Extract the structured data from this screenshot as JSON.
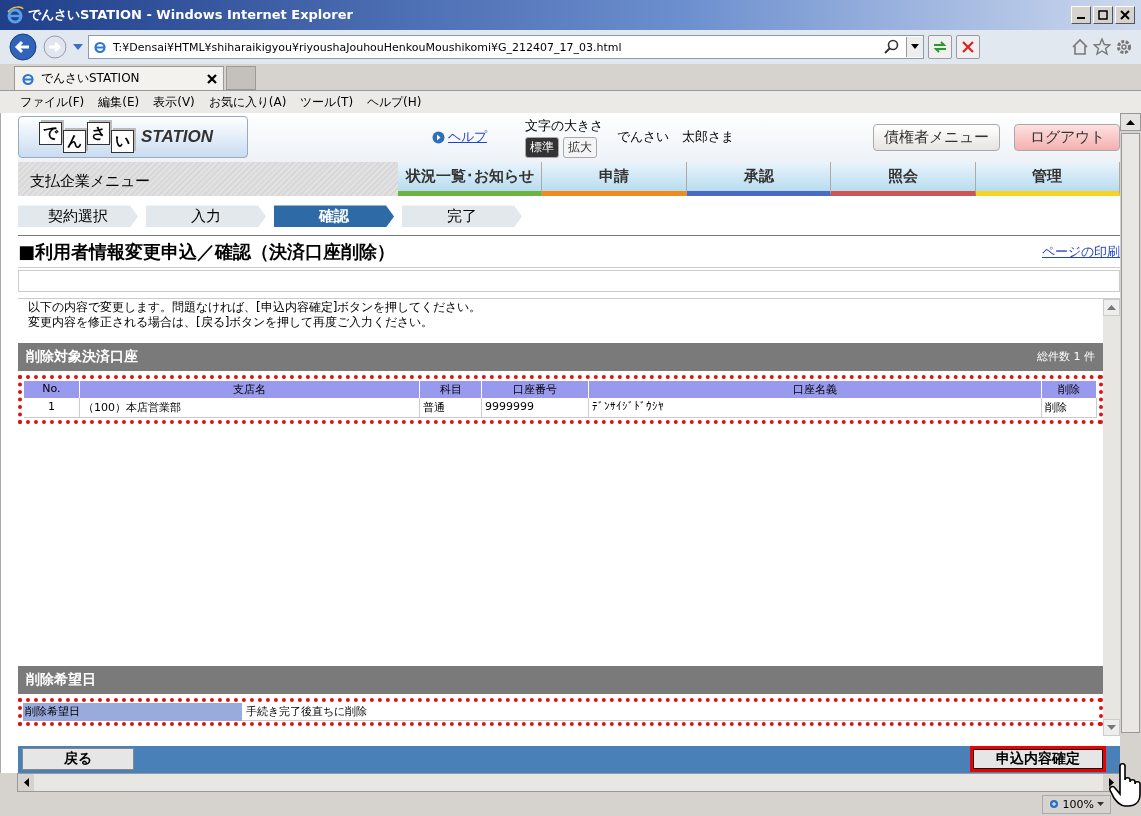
{
  "window": {
    "title": "でんさいSTATION - Windows Internet Explorer"
  },
  "address_bar": {
    "url": "T:¥Densai¥HTML¥shiharaikigyou¥riyoushaJouhouHenkouMoushikomi¥G_212407_17_03.html"
  },
  "browser_tabs": [
    {
      "label": "でんさいSTATION",
      "selected": true
    }
  ],
  "menu_bar": [
    "ファイル(F)",
    "編集(E)",
    "表示(V)",
    "お気に入り(A)",
    "ツール(T)",
    "ヘルプ(H)"
  ],
  "header": {
    "logo_letters": [
      "で",
      "ん",
      "さ",
      "い"
    ],
    "logo_text": "STATION",
    "help_link": "ヘルプ",
    "text_size_label": "文字の大きさ",
    "text_sizes": [
      {
        "label": "標準",
        "selected": true
      },
      {
        "label": "拡大",
        "selected": false
      }
    ],
    "user": "でんさい　太郎さま",
    "buttons": [
      {
        "label": "債権者メニュー",
        "kind": "normal"
      },
      {
        "label": "ログアウト",
        "kind": "logout"
      }
    ]
  },
  "nav": {
    "menu_title": "支払企業メニュー",
    "items": [
      {
        "label": "状況一覧･お知らせ",
        "color": "#6db33f"
      },
      {
        "label": "申請",
        "color": "#f08c1e"
      },
      {
        "label": "承認",
        "color": "#4a6cc0"
      },
      {
        "label": "照会",
        "color": "#d05454"
      },
      {
        "label": "管理",
        "color": "#f5d423"
      }
    ]
  },
  "steps": [
    {
      "label": "契約選択",
      "selected": false
    },
    {
      "label": "入力",
      "selected": false
    },
    {
      "label": "確認",
      "selected": true
    },
    {
      "label": "完了",
      "selected": false
    }
  ],
  "page": {
    "title": "■利用者情報変更申込／確認（決済口座削除）",
    "print_link": "ページの印刷",
    "message": [
      "以下の内容で変更します。問題なければ、[申込内容確定]ボタンを押してください。",
      "変更内容を修正される場合は、[戻る]ボタンを押して再度ご入力ください。"
    ]
  },
  "accounts_section": {
    "title": "削除対象決済口座",
    "total": "総件数 1 件",
    "table": {
      "columns": [
        "No.",
        "支店名",
        "科目",
        "口座番号",
        "口座名義",
        "削除"
      ],
      "rows": [
        [
          "1",
          "（100）本店営業部",
          "普通",
          "9999999",
          "ﾃﾞﾝｻｲｼﾞﾄﾞｳｼﾔ",
          "削除"
        ]
      ]
    }
  },
  "deletion_section": {
    "title": "削除希望日",
    "label": "削除希望日",
    "value": "手続き完了後直ちに削除"
  },
  "footer_buttons": {
    "back": "戻る",
    "confirm": "申込内容確定"
  },
  "status_bar": {
    "zoom": "100%"
  }
}
